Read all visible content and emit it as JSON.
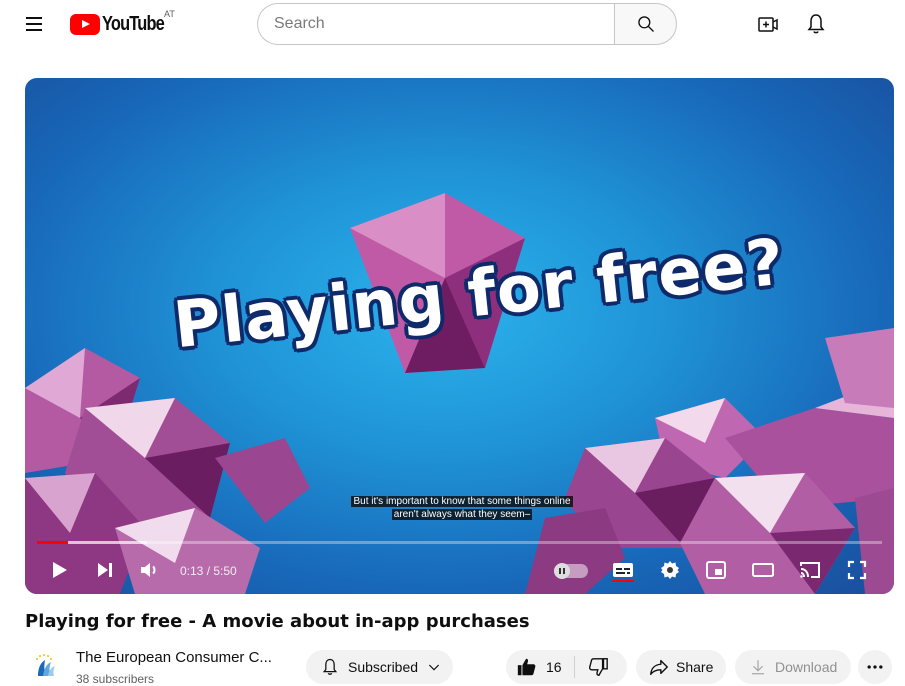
{
  "header": {
    "logo_text": "YouTube",
    "country_code": "AT",
    "search_placeholder": "Search",
    "icons": [
      "menu-icon",
      "youtube-logo",
      "search-icon",
      "create-icon",
      "notifications-icon"
    ]
  },
  "player": {
    "art_title": "Playing for free?",
    "caption_line1": "But it's important to know that some things online",
    "caption_line2": "aren't always what they seem–",
    "time_display": "0:13 / 5:50",
    "progress_played": 0.037,
    "progress_buffered": 0.13,
    "icons": [
      "play-icon",
      "next-icon",
      "volume-icon",
      "autoplay-toggle",
      "subtitles-icon",
      "settings-icon",
      "miniplayer-icon",
      "theater-mode-icon",
      "cast-icon",
      "fullscreen-icon"
    ]
  },
  "video": {
    "title": "Playing for free - A movie about in-app purchases"
  },
  "channel": {
    "name": "The European Consumer C...",
    "subscribers": "38 subscribers",
    "subscribed_label": "Subscribed"
  },
  "actions": {
    "like_count": "16",
    "share_label": "Share",
    "download_label": "Download"
  },
  "colors": {
    "accent_red": "#ff0000",
    "player_blue": "#1f93d6",
    "pill_bg": "#f2f2f2"
  }
}
